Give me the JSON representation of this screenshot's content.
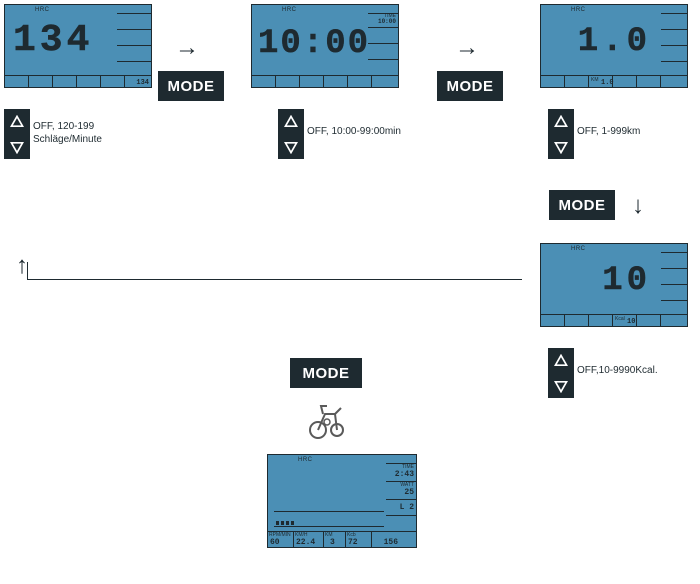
{
  "screens": {
    "hrc": {
      "label": "HRC",
      "value": "134",
      "small": "134"
    },
    "time": {
      "label": "HRC",
      "value": "10:00",
      "side_label": "TIME",
      "side_val": "10:00"
    },
    "km": {
      "label": "HRC",
      "value": "1.0",
      "foot_label": "KM",
      "foot_small": "1.0"
    },
    "kcal": {
      "label": "HRC",
      "value": "10",
      "foot_label": "Kcal",
      "foot_small": "10"
    },
    "run": {
      "label": "HRC",
      "time_label": "TIME",
      "time_val": "2:43",
      "watt_label": "WATT",
      "watt_val": "25",
      "level": "L 2",
      "rpm_label": "RPM/MIN",
      "rpm": "60",
      "kmh_label": "KM/H",
      "kmh": "22.4",
      "km_label": "KM",
      "km": "3",
      "kcb_label": "Kcb",
      "kcb": "72",
      "hr": "156"
    }
  },
  "desc": {
    "hrc_1": "OFF, 120-199",
    "hrc_2": "Schläge/Minute",
    "time": "OFF, 10:00-99:00min",
    "km": "OFF, 1-999km",
    "kcal": "OFF,10-9990Kcal."
  },
  "labels": {
    "mode": "MODE"
  },
  "icons": {
    "up": "up-triangle",
    "down": "down-triangle",
    "bike": "exercise-bike"
  }
}
